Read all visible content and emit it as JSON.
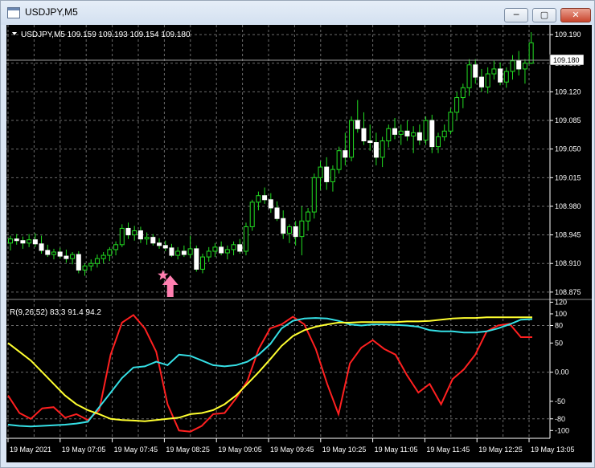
{
  "window": {
    "title": "USDJPY,M5",
    "min_glyph": "─",
    "max_glyph": "▢",
    "close_glyph": "✕"
  },
  "main_chart": {
    "info": "USDJPY,M5  109.159 109.193 109.154 109.180",
    "current_price_label": "109.180",
    "price_ticks": [
      "109.190",
      "109.155",
      "109.120",
      "109.085",
      "109.050",
      "109.015",
      "108.980",
      "108.945",
      "108.910",
      "108.875"
    ],
    "arrow_color": "#ff7fb0"
  },
  "indicator": {
    "label": "R(9,26,52) 83.3 91.4 94.2",
    "ticks": [
      "120",
      "100",
      "80",
      "50",
      "0.00",
      "-50",
      "-80",
      "-100"
    ],
    "colors": {
      "line1": "#ff2020",
      "line2": "#35e0e6",
      "line3": "#ffff30"
    }
  },
  "time_axis": {
    "labels": [
      "19 May 2021",
      "19 May 07:05",
      "19 May 07:45",
      "19 May 08:25",
      "19 May 09:05",
      "19 May 09:45",
      "19 May 10:25",
      "19 May 11:05",
      "19 May 11:45",
      "19 May 12:25",
      "19 May 13:05"
    ]
  },
  "chart_data": {
    "type": "candlestick",
    "symbol": "USDJPY",
    "timeframe": "M5",
    "ylim": [
      108.868,
      109.198
    ],
    "candles": [
      [
        108.935,
        108.944,
        108.926,
        108.94
      ],
      [
        108.94,
        108.946,
        108.933,
        108.938
      ],
      [
        108.938,
        108.943,
        108.928,
        108.935
      ],
      [
        108.935,
        108.946,
        108.93,
        108.939
      ],
      [
        108.939,
        108.947,
        108.93,
        108.934
      ],
      [
        108.934,
        108.944,
        108.922,
        108.926
      ],
      [
        108.926,
        108.933,
        108.918,
        108.921
      ],
      [
        108.921,
        108.928,
        108.915,
        108.924
      ],
      [
        108.924,
        108.929,
        108.916,
        108.919
      ],
      [
        108.919,
        108.927,
        108.911,
        108.916
      ],
      [
        108.916,
        108.924,
        108.909,
        108.921
      ],
      [
        108.921,
        108.925,
        108.898,
        108.902
      ],
      [
        108.902,
        108.91,
        108.895,
        108.907
      ],
      [
        108.907,
        108.915,
        108.901,
        108.91
      ],
      [
        108.91,
        108.921,
        108.905,
        108.916
      ],
      [
        108.916,
        108.924,
        108.91,
        108.92
      ],
      [
        108.92,
        108.93,
        108.913,
        108.927
      ],
      [
        108.927,
        108.937,
        108.92,
        108.933
      ],
      [
        108.933,
        108.958,
        108.93,
        108.953
      ],
      [
        108.953,
        108.96,
        108.94,
        108.945
      ],
      [
        108.945,
        108.956,
        108.938,
        108.95
      ],
      [
        108.95,
        108.955,
        108.935,
        108.94
      ],
      [
        108.94,
        108.948,
        108.933,
        108.942
      ],
      [
        108.942,
        108.946,
        108.932,
        108.935
      ],
      [
        108.935,
        108.941,
        108.928,
        108.932
      ],
      [
        108.932,
        108.938,
        108.925,
        108.929
      ],
      [
        108.929,
        108.934,
        108.918,
        108.92
      ],
      [
        108.92,
        108.93,
        108.915,
        108.925
      ],
      [
        108.925,
        108.932,
        108.918,
        108.921
      ],
      [
        108.921,
        108.944,
        108.917,
        108.928
      ],
      [
        108.928,
        108.932,
        108.9,
        108.903
      ],
      [
        108.903,
        108.922,
        108.898,
        108.918
      ],
      [
        108.918,
        108.93,
        108.912,
        108.925
      ],
      [
        108.925,
        108.935,
        108.918,
        108.93
      ],
      [
        108.93,
        108.937,
        108.92,
        108.923
      ],
      [
        108.923,
        108.932,
        108.915,
        108.927
      ],
      [
        108.927,
        108.937,
        108.92,
        108.933
      ],
      [
        108.933,
        108.94,
        108.922,
        108.925
      ],
      [
        108.925,
        108.96,
        108.92,
        108.955
      ],
      [
        108.955,
        108.988,
        108.95,
        108.985
      ],
      [
        108.985,
        108.998,
        108.975,
        108.993
      ],
      [
        108.993,
        109.003,
        108.983,
        108.988
      ],
      [
        108.988,
        108.996,
        108.972,
        108.978
      ],
      [
        108.978,
        108.986,
        108.962,
        108.965
      ],
      [
        108.965,
        108.975,
        108.94,
        108.947
      ],
      [
        108.947,
        108.958,
        108.935,
        108.955
      ],
      [
        108.955,
        108.962,
        108.932,
        108.943
      ],
      [
        108.943,
        108.98,
        108.92,
        108.962
      ],
      [
        108.962,
        108.978,
        108.95,
        108.973
      ],
      [
        108.973,
        109.02,
        108.965,
        109.015
      ],
      [
        109.015,
        109.035,
        109.0,
        109.028
      ],
      [
        109.028,
        109.04,
        109.0,
        109.01
      ],
      [
        109.01,
        109.03,
        108.998,
        109.025
      ],
      [
        109.025,
        109.053,
        109.02,
        109.048
      ],
      [
        109.048,
        109.07,
        109.03,
        109.04
      ],
      [
        109.04,
        109.09,
        109.035,
        109.085
      ],
      [
        109.085,
        109.11,
        109.07,
        109.075
      ],
      [
        109.075,
        109.095,
        109.055,
        109.06
      ],
      [
        109.06,
        109.08,
        109.048,
        109.058
      ],
      [
        109.058,
        109.07,
        109.03,
        109.04
      ],
      [
        109.04,
        109.065,
        109.028,
        109.06
      ],
      [
        109.06,
        109.08,
        109.052,
        109.075
      ],
      [
        109.075,
        109.088,
        109.062,
        109.068
      ],
      [
        109.068,
        109.08,
        109.055,
        109.072
      ],
      [
        109.072,
        109.085,
        109.06,
        109.066
      ],
      [
        109.066,
        109.078,
        109.045,
        109.07
      ],
      [
        109.07,
        109.08,
        109.055,
        109.061
      ],
      [
        109.061,
        109.09,
        109.055,
        109.085
      ],
      [
        109.085,
        109.092,
        109.045,
        109.053
      ],
      [
        109.053,
        109.07,
        109.045,
        109.065
      ],
      [
        109.065,
        109.08,
        109.06,
        109.072
      ],
      [
        109.072,
        109.1,
        109.068,
        109.095
      ],
      [
        109.095,
        109.12,
        109.085,
        109.113
      ],
      [
        109.113,
        109.13,
        109.1,
        109.125
      ],
      [
        109.125,
        109.16,
        109.115,
        109.153
      ],
      [
        109.153,
        109.16,
        109.13,
        109.138
      ],
      [
        109.138,
        109.148,
        109.12,
        109.126
      ],
      [
        109.126,
        109.15,
        109.118,
        109.142
      ],
      [
        109.142,
        109.158,
        109.135,
        109.148
      ],
      [
        109.148,
        109.156,
        109.128,
        109.132
      ],
      [
        109.132,
        109.15,
        109.125,
        109.145
      ],
      [
        109.145,
        109.165,
        109.135,
        109.158
      ],
      [
        109.158,
        109.17,
        109.14,
        109.148
      ],
      [
        109.148,
        109.16,
        109.13,
        109.155
      ],
      [
        109.155,
        109.193,
        109.154,
        109.18
      ]
    ],
    "indicator_ylim": [
      -112,
      122
    ],
    "indicator_series": [
      {
        "values": [
          -40,
          -70,
          -80,
          -62,
          -60,
          -78,
          -72,
          -82,
          -65,
          30,
          85,
          98,
          75,
          35,
          -55,
          -100,
          -102,
          -92,
          -72,
          -70,
          -45,
          -15,
          40,
          75,
          82,
          95,
          82,
          40,
          -20,
          -72,
          15,
          42,
          55,
          40,
          30,
          -5,
          -35,
          -20,
          -55,
          -12,
          5,
          30,
          70,
          80,
          83,
          60,
          60
        ]
      },
      {
        "values": [
          -90,
          -92,
          -93,
          -92,
          -91,
          -90,
          -88,
          -85,
          -60,
          -35,
          -10,
          8,
          10,
          18,
          12,
          30,
          28,
          20,
          12,
          10,
          12,
          18,
          30,
          48,
          75,
          88,
          92,
          93,
          92,
          88,
          82,
          80,
          82,
          82,
          81,
          80,
          78,
          72,
          70,
          70,
          68,
          68,
          70,
          75,
          82,
          90,
          91
        ]
      },
      {
        "values": [
          50,
          35,
          20,
          0,
          -20,
          -40,
          -55,
          -65,
          -72,
          -80,
          -82,
          -83,
          -84,
          -82,
          -80,
          -78,
          -72,
          -70,
          -65,
          -55,
          -40,
          -20,
          0,
          22,
          45,
          62,
          72,
          78,
          82,
          85,
          85,
          86,
          86,
          86,
          86,
          87,
          87,
          88,
          90,
          92,
          93,
          93,
          94,
          94,
          94,
          94,
          94
        ]
      }
    ]
  }
}
